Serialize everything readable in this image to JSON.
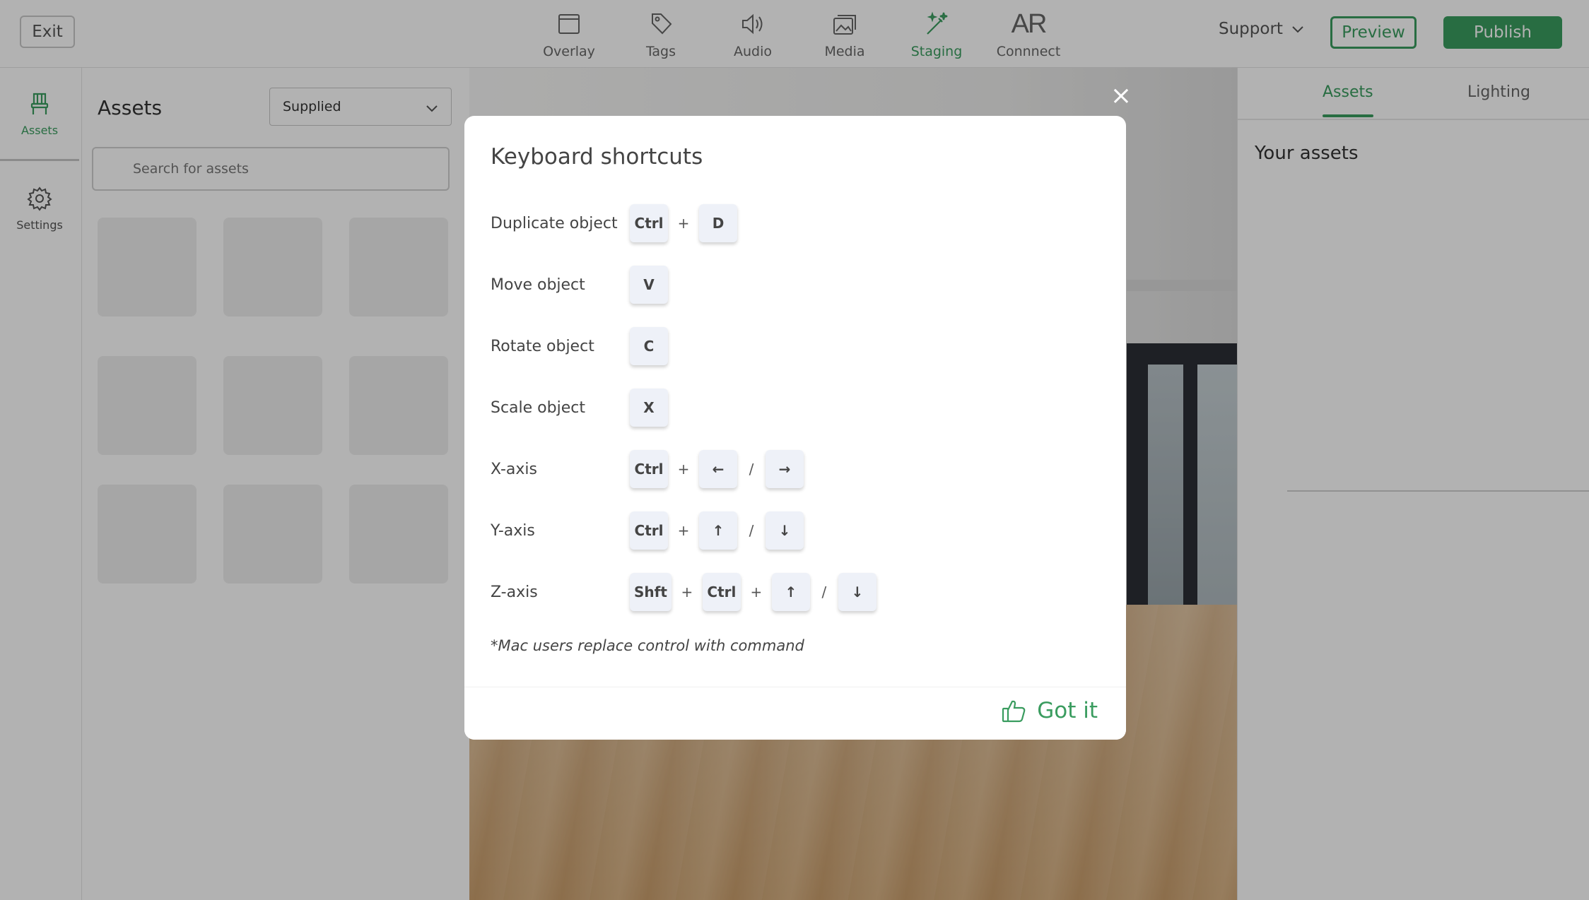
{
  "topbar": {
    "exit_label": "Exit",
    "nav": [
      {
        "label": "Overlay",
        "icon": "overlay-icon"
      },
      {
        "label": "Tags",
        "icon": "tag-icon"
      },
      {
        "label": "Audio",
        "icon": "speaker-icon"
      },
      {
        "label": "Media",
        "icon": "images-icon"
      },
      {
        "label": "Staging",
        "icon": "magic-wand-icon",
        "active": true
      },
      {
        "label": "Connnect",
        "icon_text": "AR"
      }
    ],
    "support_label": "Support",
    "preview_label": "Preview",
    "publish_label": "Publish"
  },
  "rail": {
    "items": [
      {
        "label": "Assets",
        "icon": "chair-icon",
        "active": true
      },
      {
        "label": "Settings",
        "icon": "gear-icon"
      }
    ]
  },
  "assets_panel": {
    "title": "Assets",
    "filter_value": "Supplied",
    "search_placeholder": "Search for assets"
  },
  "right_panel": {
    "tabs": [
      {
        "label": "Assets",
        "active": true
      },
      {
        "label": "Lighting"
      }
    ],
    "section_title": "Your assets"
  },
  "modal": {
    "title": "Keyboard shortcuts",
    "rows": [
      {
        "label": "Duplicate object",
        "keys": [
          "Ctrl",
          "+",
          "D"
        ]
      },
      {
        "label": "Move object",
        "keys": [
          "V"
        ]
      },
      {
        "label": "Rotate object",
        "keys": [
          "C"
        ]
      },
      {
        "label": "Scale object",
        "keys": [
          "X"
        ]
      },
      {
        "label": "X-axis",
        "keys": [
          "Ctrl",
          "+",
          "←",
          "/",
          "→"
        ]
      },
      {
        "label": "Y-axis",
        "keys": [
          "Ctrl",
          "+",
          "↑",
          "/",
          "↓"
        ]
      },
      {
        "label": "Z-axis",
        "keys": [
          "Shft",
          "+",
          "Ctrl",
          "+",
          "↑",
          "/",
          "↓"
        ]
      }
    ],
    "note": "*Mac users replace control with command",
    "confirm_label": "Got it",
    "close_symbol": "×"
  },
  "colors": {
    "accent": "#3a9c5f",
    "key_bg": "#eef1f8",
    "overlay": "rgba(0,0,0,0.30)"
  }
}
